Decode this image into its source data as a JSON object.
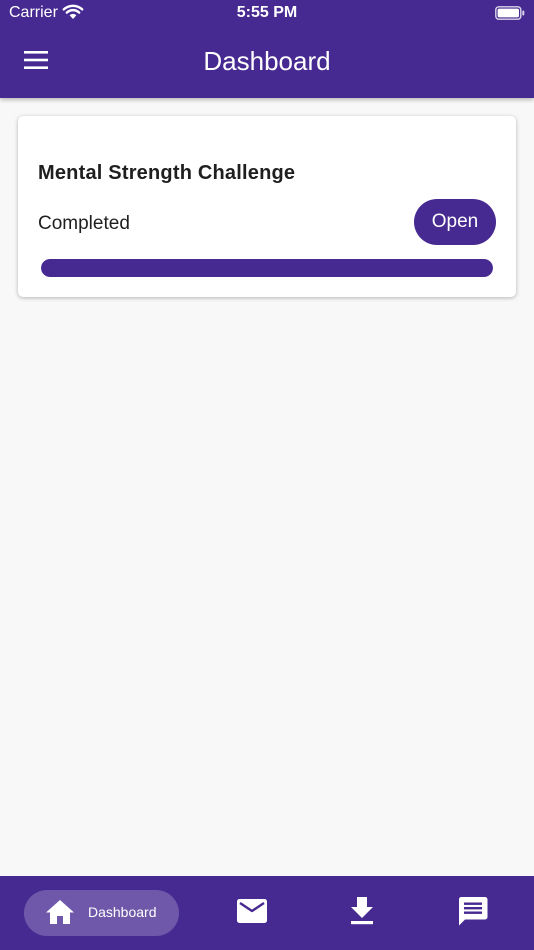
{
  "status_bar": {
    "carrier": "Carrier",
    "time": "5:55 PM"
  },
  "header": {
    "title": "Dashboard",
    "menu_icon": "hamburger-menu-icon"
  },
  "card": {
    "title": "Mental Strength Challenge",
    "status": "Completed",
    "open_label": "Open",
    "progress": 1.0
  },
  "bottom_nav": {
    "items": [
      {
        "label": "Dashboard",
        "icon": "home-icon",
        "active": true
      },
      {
        "label": "",
        "icon": "mail-icon",
        "active": false
      },
      {
        "label": "",
        "icon": "download-icon",
        "active": false
      },
      {
        "label": "",
        "icon": "chat-icon",
        "active": false
      }
    ]
  },
  "colors": {
    "primary": "#472a91",
    "background": "#f8f8f8",
    "card": "#ffffff",
    "text": "#1f1f1f"
  }
}
